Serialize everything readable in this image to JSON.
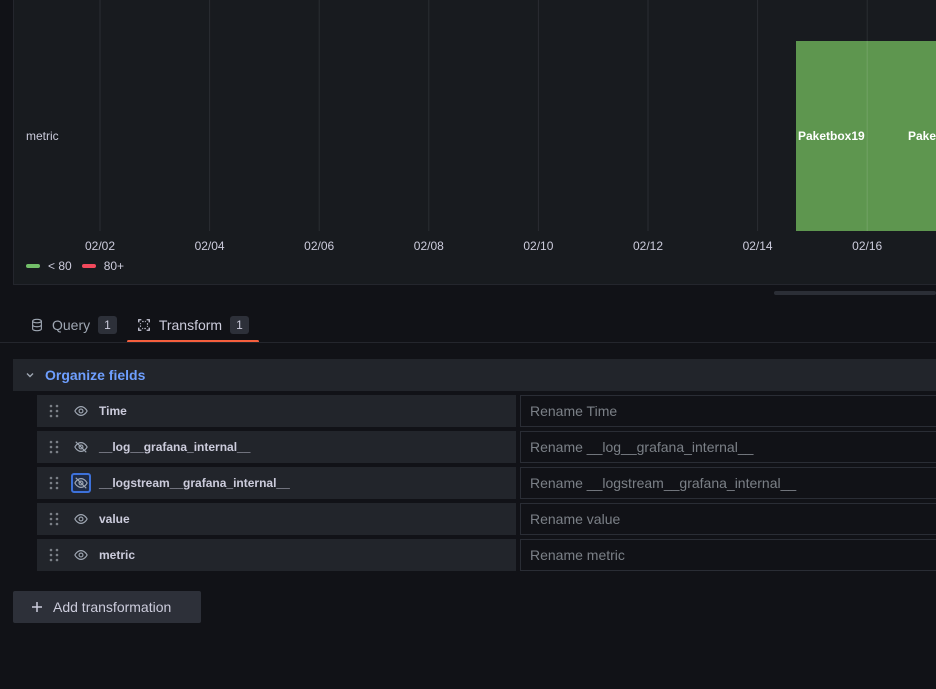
{
  "chart": {
    "y_axis_label": "metric",
    "x_ticks": [
      "02/02",
      "02/04",
      "02/06",
      "02/08",
      "02/10",
      "02/12",
      "02/14",
      "02/16"
    ],
    "bar_labels": [
      "Paketbox19",
      "Pake"
    ],
    "bar_color": "#5e964f",
    "legend": [
      {
        "label": "< 80",
        "color": "#73bf69"
      },
      {
        "label": "80+",
        "color": "#f2495c"
      }
    ]
  },
  "tabs": [
    {
      "label": "Query",
      "count": "1",
      "icon": "database-icon",
      "active": false
    },
    {
      "label": "Transform",
      "count": "1",
      "icon": "transform-icon",
      "active": true
    }
  ],
  "transformation": {
    "title": "Organize fields",
    "fields": [
      {
        "name": "Time",
        "placeholder": "Rename Time",
        "visible": true
      },
      {
        "name": "__log__grafana_internal__",
        "placeholder": "Rename __log__grafana_internal__",
        "visible": false
      },
      {
        "name": "__logstream__grafana_internal__",
        "placeholder": "Rename __logstream__grafana_internal__",
        "visible": false,
        "focused": true
      },
      {
        "name": "value",
        "placeholder": "Rename value",
        "visible": true
      },
      {
        "name": "metric",
        "placeholder": "Rename metric",
        "visible": true
      }
    ]
  },
  "add_transformation_label": "Add transformation"
}
